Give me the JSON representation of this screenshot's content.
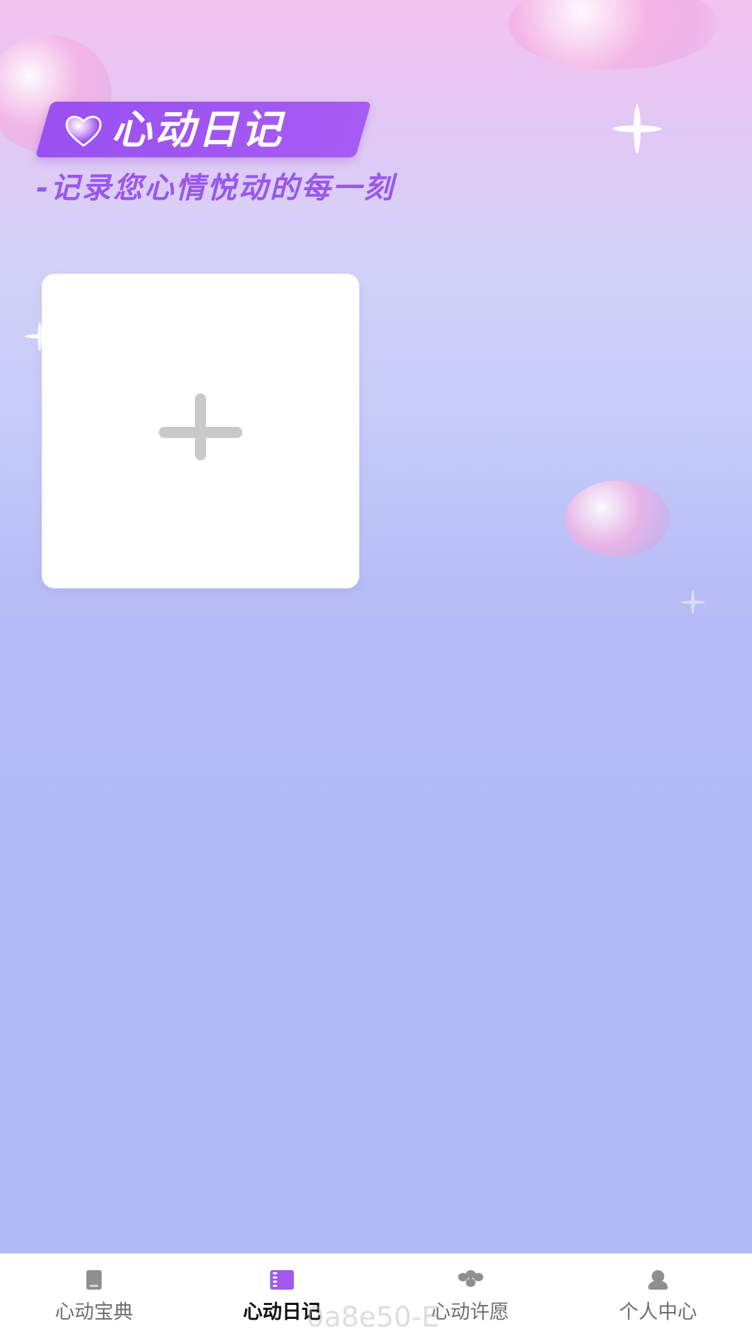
{
  "header": {
    "title": "心动日记",
    "subtitle": "-记录您心情悦动的每一刻",
    "title_icon": "heart-icon"
  },
  "main": {
    "add_card": {
      "icon": "plus-icon"
    }
  },
  "bottom_nav": {
    "items": [
      {
        "label": "心动宝典",
        "icon": "book-icon",
        "active": false
      },
      {
        "label": "心动日记",
        "icon": "notebook-icon",
        "active": true
      },
      {
        "label": "心动许愿",
        "icon": "clover-icon",
        "active": false
      },
      {
        "label": "个人中心",
        "icon": "person-icon",
        "active": false
      }
    ]
  },
  "watermark": "0a8e50-E",
  "colors": {
    "accent": "#a159ef",
    "banner": "#9a4ff1",
    "nav_text": "#6f6f6f",
    "nav_text_active": "#111111"
  }
}
